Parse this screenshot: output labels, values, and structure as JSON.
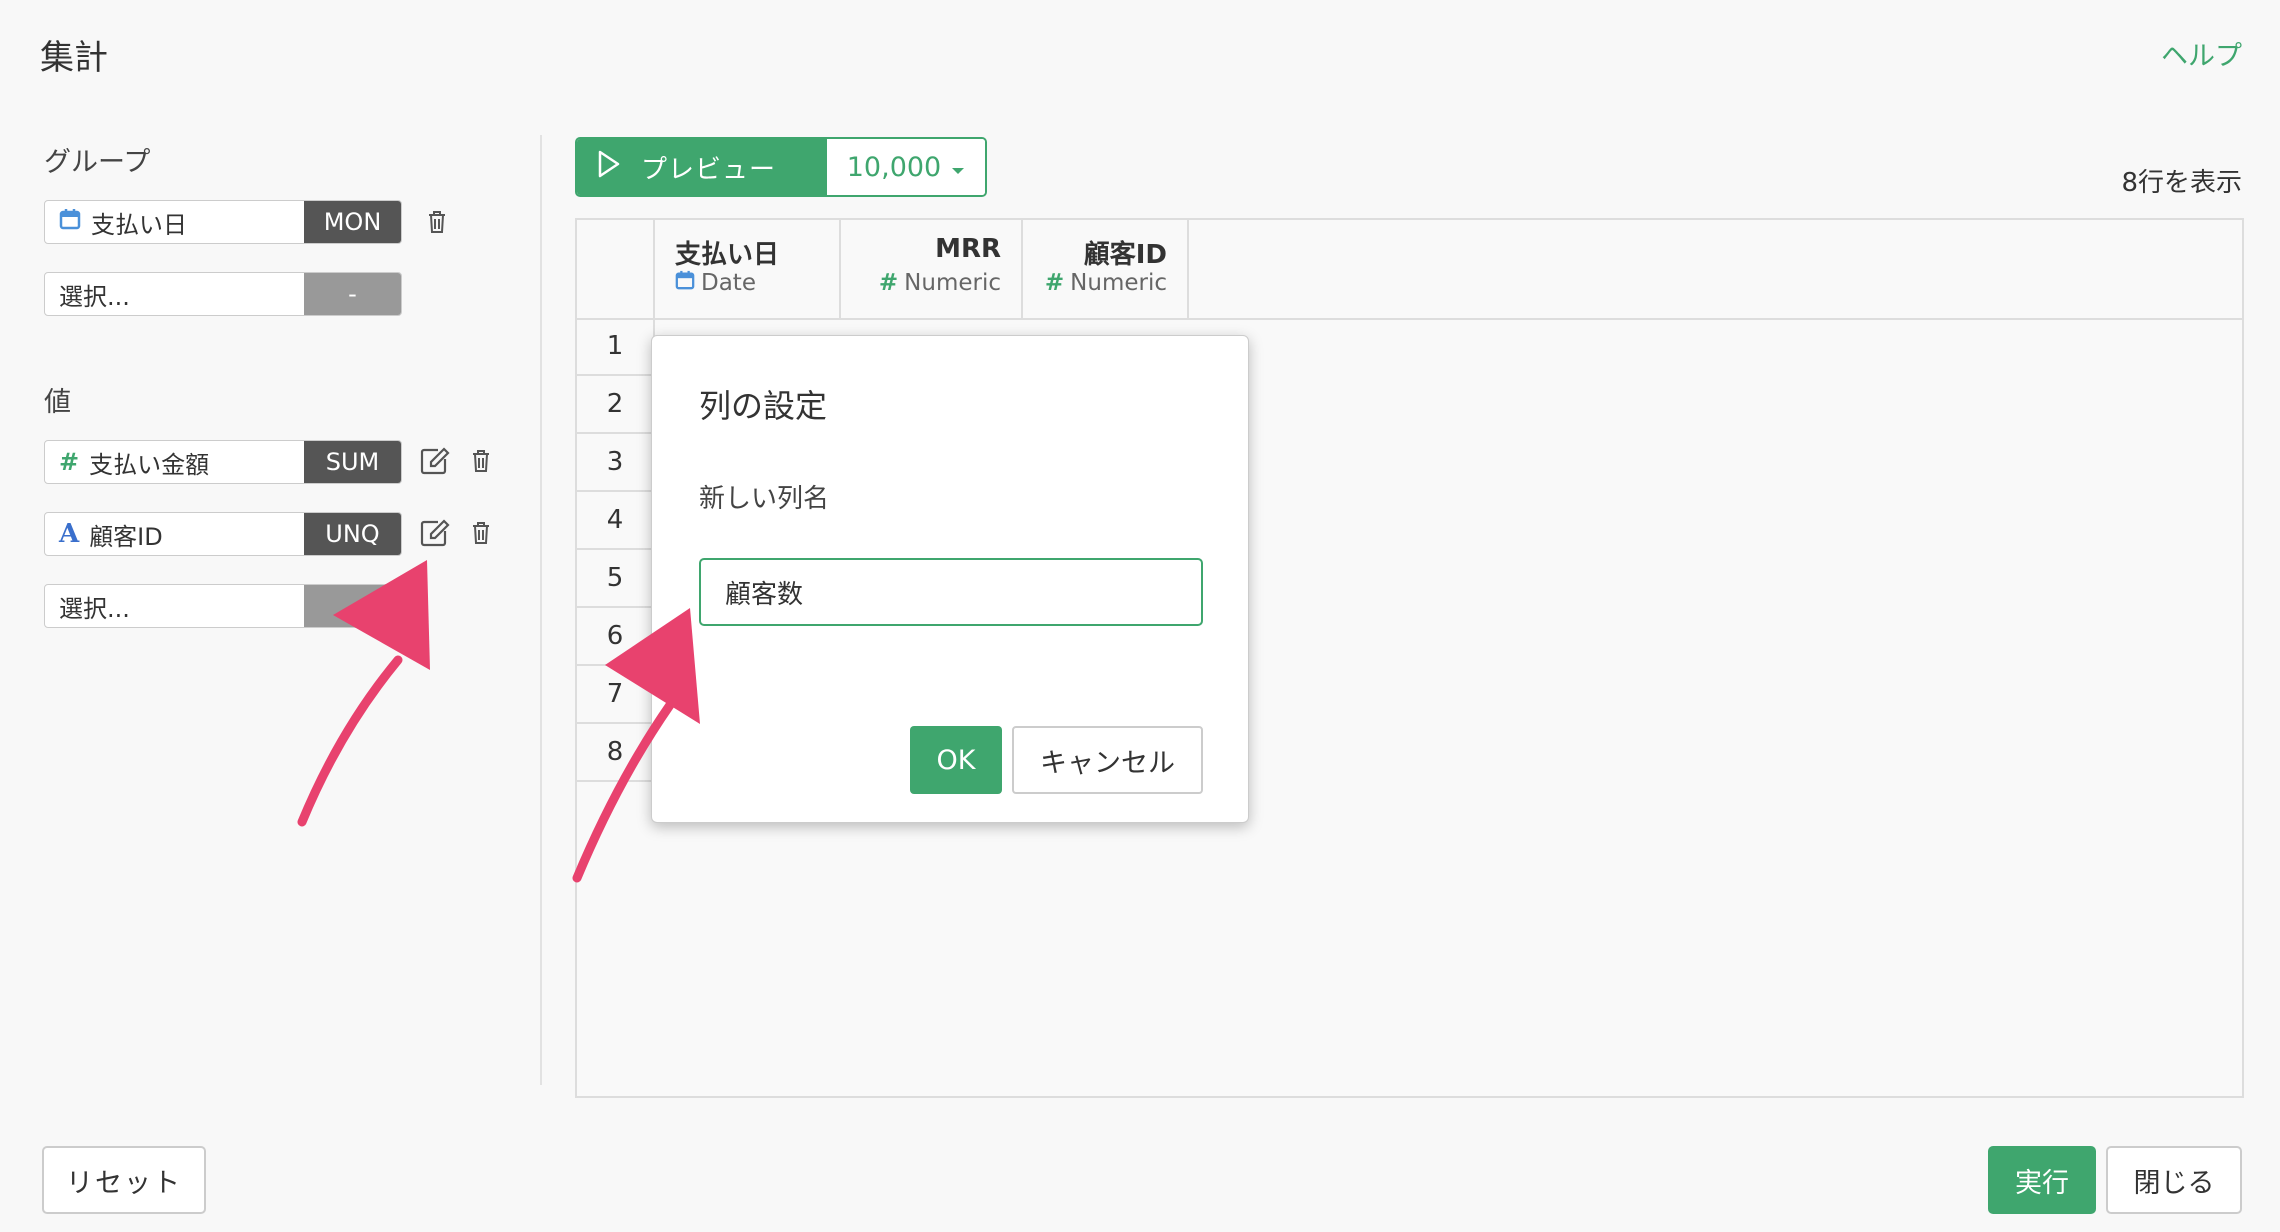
{
  "header": {
    "title": "集計",
    "help": "ヘルプ"
  },
  "group": {
    "label": "グループ",
    "items": [
      {
        "field": "支払い日",
        "icon": "calendar-icon",
        "agg": "MON"
      },
      {
        "field": "選択...",
        "agg": "-"
      }
    ]
  },
  "values": {
    "label": "値",
    "items": [
      {
        "icon_text": "#",
        "field": "支払い金額",
        "agg": "SUM"
      },
      {
        "icon_text": "A",
        "field": "顧客ID",
        "agg": "UNQ"
      },
      {
        "field": "選択...",
        "agg": "-"
      }
    ]
  },
  "toolbar": {
    "preview": "プレビュー",
    "count": "10,000",
    "rows_shown": "8行を表示"
  },
  "table": {
    "columns": [
      {
        "name": "支払い日",
        "type": "Date",
        "type_icon": "calendar-icon"
      },
      {
        "name": "MRR",
        "type": "Numeric",
        "type_icon_text": "#"
      },
      {
        "name": "顧客ID",
        "type": "Numeric",
        "type_icon_text": "#"
      }
    ],
    "row_numbers": [
      "1",
      "2",
      "3",
      "4",
      "5",
      "6",
      "7",
      "8"
    ]
  },
  "dialog": {
    "title": "列の設定",
    "label": "新しい列名",
    "input_value": "顧客数",
    "ok": "OK",
    "cancel": "キャンセル"
  },
  "footer": {
    "reset": "リセット",
    "run": "実行",
    "close": "閉じる"
  },
  "colors": {
    "accent": "#3fa66e",
    "annotation_arrow": "#e8426e",
    "dark_badge": "#555555"
  }
}
